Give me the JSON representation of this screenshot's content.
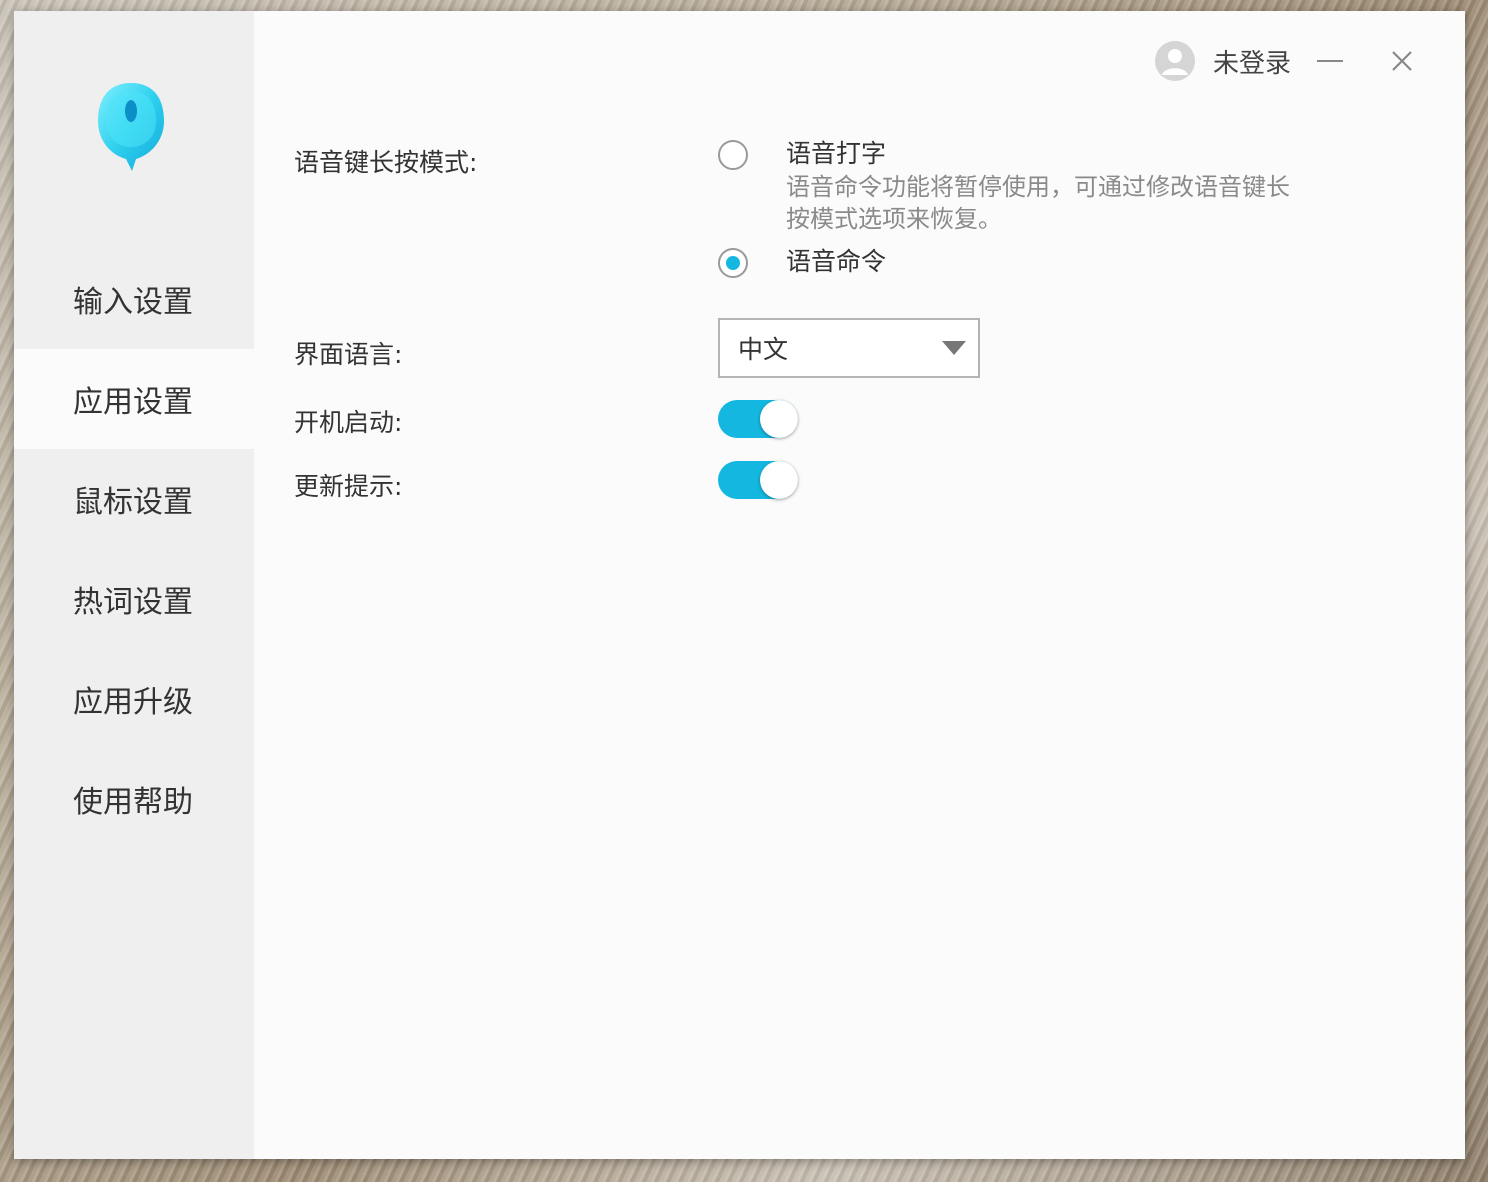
{
  "colors": {
    "accent": "#14b7df",
    "sidebar_bg": "#efefef",
    "content_bg": "#fbfbfb"
  },
  "sidebar": {
    "logo_icon": "microphone-droplet-logo",
    "items": [
      {
        "label": "输入设置",
        "active": false
      },
      {
        "label": "应用设置",
        "active": true
      },
      {
        "label": "鼠标设置",
        "active": false
      },
      {
        "label": "热词设置",
        "active": false
      },
      {
        "label": "应用升级",
        "active": false
      },
      {
        "label": "使用帮助",
        "active": false
      }
    ]
  },
  "topbar": {
    "user_label": "未登录",
    "avatar_icon": "user-avatar-icon",
    "minimize_icon": "minimize-icon",
    "close_icon": "close-icon"
  },
  "settings": {
    "voice_key_mode": {
      "label": "语音键长按模式:",
      "options": [
        {
          "label": "语音打字",
          "description": "语音命令功能将暂停使用，可通过修改语音键长按模式选项来恢复。",
          "checked": false
        },
        {
          "label": "语音命令",
          "checked": true
        }
      ]
    },
    "ui_language": {
      "label": "界面语言:",
      "value": "中文"
    },
    "auto_start": {
      "label": "开机启动:",
      "on": true
    },
    "update_notice": {
      "label": "更新提示:",
      "on": true
    }
  }
}
